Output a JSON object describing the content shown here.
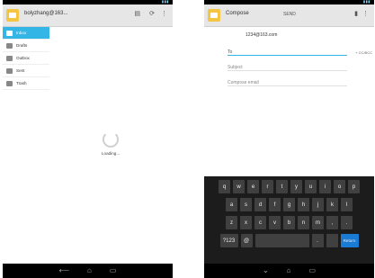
{
  "left": {
    "account": "bolyzhang@163...",
    "drawer": [
      "Inbox",
      "Drafts",
      "Outbox",
      "Sent",
      "Trash"
    ],
    "loading": "Loading..."
  },
  "right": {
    "title": "Compose",
    "send_label": "SEND",
    "from": "1234@163.com",
    "to_label": "To",
    "subject_placeholder": "Subject",
    "body_placeholder": "Compose email",
    "cc_label": "+ CC/BCC",
    "keys": {
      "row1": [
        "q",
        "w",
        "e",
        "r",
        "t",
        "y",
        "u",
        "i",
        "o",
        "p"
      ],
      "row2": [
        "a",
        "s",
        "d",
        "f",
        "g",
        "h",
        "j",
        "k",
        "l"
      ],
      "row3": [
        "z",
        "x",
        "c",
        "v",
        "b",
        "n",
        "m",
        ",",
        "."
      ],
      "row4": [
        "?123",
        "@",
        "",
        ".",
        "",
        "Return"
      ]
    }
  },
  "icons": {
    "app": "mail-icon",
    "refresh": "refresh-icon",
    "menu": "overflow-menu-icon"
  },
  "colors": {
    "accent": "#33b5e5",
    "keyboard": "#1c1c1c"
  }
}
